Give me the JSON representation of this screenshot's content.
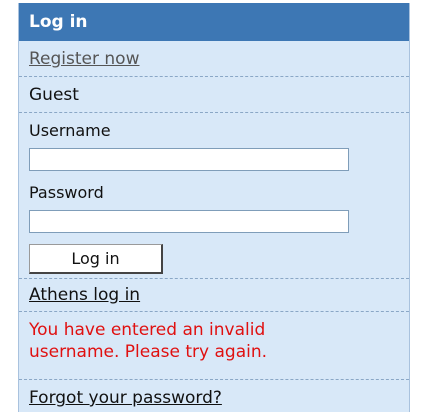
{
  "login": {
    "title": "Log in",
    "register_link": "Register now",
    "guest_label": "Guest",
    "username_label": "Username",
    "username_value": "",
    "password_label": "Password",
    "password_value": "",
    "login_button": "Log in",
    "athens_link": "Athens log in",
    "error_line1": "You have entered an invalid",
    "error_line2": "username. Please try again.",
    "forgot_link": "Forgot your password?"
  },
  "colors": {
    "header_bg": "#3d77b4",
    "panel_bg": "#d8e8f8",
    "error_text": "#e01010"
  }
}
